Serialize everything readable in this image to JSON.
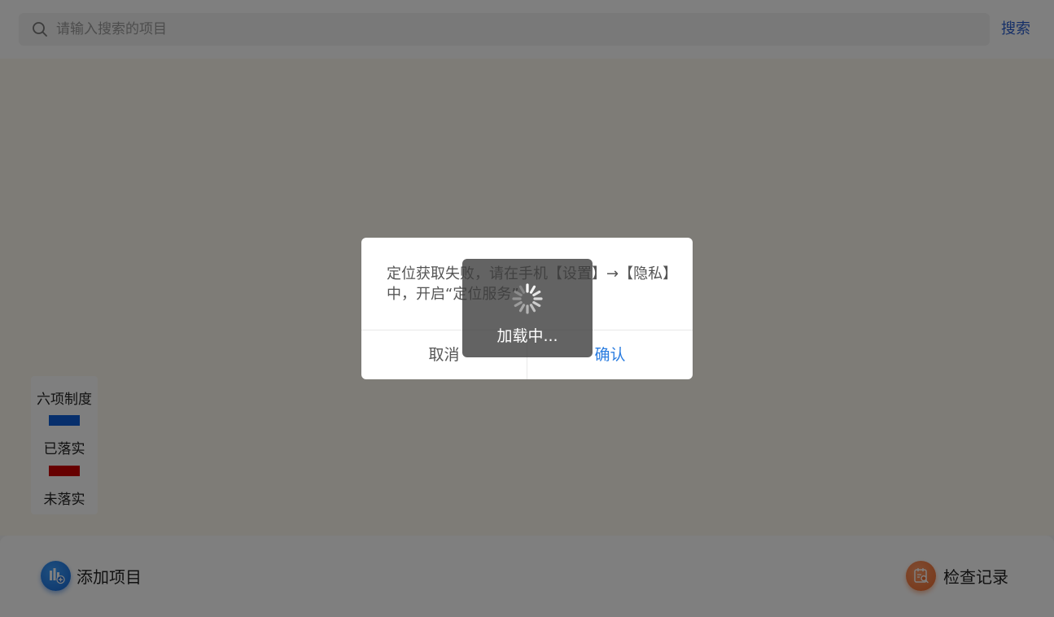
{
  "search": {
    "placeholder": "请输入搜索的项目",
    "value": "",
    "button_label": "搜索",
    "icon": "search-icon"
  },
  "legend": {
    "title": "六项制度",
    "items": [
      {
        "label": "已落实",
        "color": "#0f5ed8"
      },
      {
        "label": "未落实",
        "color": "#cc0000"
      }
    ]
  },
  "bottom_bar": {
    "add_project": {
      "label": "添加项目",
      "icon": "add-project-icon",
      "color": "#1467d6"
    },
    "check_record": {
      "label": "检查记录",
      "icon": "check-record-icon",
      "color": "#ee6a2c"
    }
  },
  "dialog": {
    "message": "定位获取失败，请在手机【设置】→【隐私】中，开启“定位服务”",
    "cancel_label": "取消",
    "confirm_label": "确认",
    "confirm_color": "#2b7de0"
  },
  "loading_toast": {
    "text": "加载中...",
    "icon": "spinner-icon"
  }
}
